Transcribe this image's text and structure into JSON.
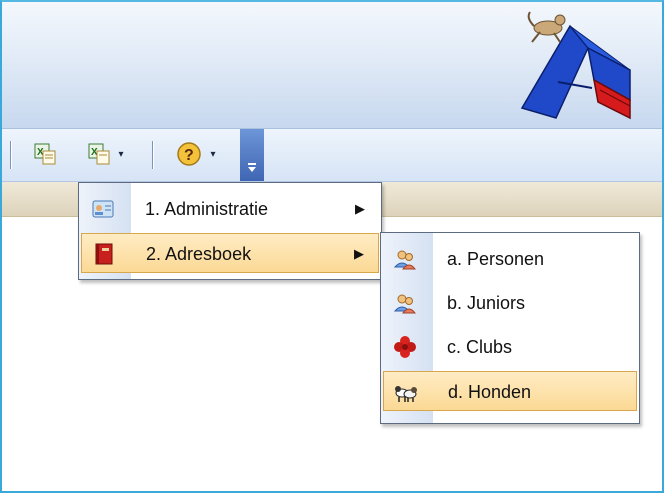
{
  "menu": {
    "items": [
      {
        "label": "1. Administratie",
        "icon": "contact-card-icon",
        "has_submenu": true
      },
      {
        "label": "2. Adresboek",
        "icon": "red-book-icon",
        "has_submenu": true,
        "highlighted": true
      }
    ]
  },
  "submenu": {
    "items": [
      {
        "label": "a. Personen",
        "icon": "people-icon"
      },
      {
        "label": "b. Juniors",
        "icon": "people-icon"
      },
      {
        "label": "c. Clubs",
        "icon": "red-flower-icon"
      },
      {
        "label": "d. Honden",
        "icon": "dogs-icon",
        "highlighted": true
      }
    ]
  },
  "toolbar": {
    "buttons": [
      "excel-export-icon",
      "excel-export-dropdown-icon",
      "help-icon"
    ],
    "submenu_arrow": "▶",
    "dropdown_arrow": "▾"
  },
  "colors": {
    "highlight": "#fbd995",
    "highlight_border": "#d8a64c",
    "window_border": "#3aa8d8",
    "logo_blue": "#1f49c9",
    "logo_red": "#d51b1b"
  }
}
